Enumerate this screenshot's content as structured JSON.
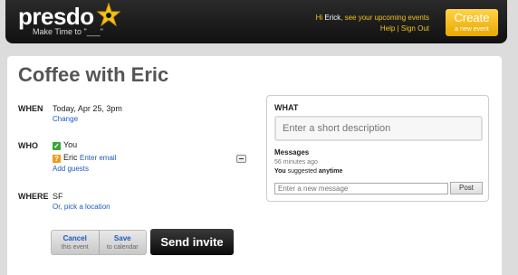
{
  "header": {
    "logo": "presdo",
    "tagline": "Make Time to \"___\"",
    "greeting_prefix": "Hi",
    "greeting_user": "Erick",
    "greeting_suffix": ", see your upcoming events",
    "help_link": "Help",
    "separator": "|",
    "signout_link": "Sign Out",
    "create_label": "Create",
    "create_sub": "a new event",
    "colors": {
      "accent": "#f0c419",
      "background": "#111111"
    }
  },
  "event": {
    "title": "Coffee with Eric",
    "when": {
      "label": "WHEN",
      "value": "Today, Apr 25, 3pm",
      "change_link": "Change"
    },
    "who": {
      "label": "WHO",
      "attendees": [
        {
          "name": "You",
          "status_icon": "check-icon"
        },
        {
          "name": "Eric",
          "status_icon": "question-icon",
          "action": "Enter email"
        }
      ],
      "add_guests_link": "Add guests"
    },
    "where": {
      "label": "WHERE",
      "value": "SF",
      "pick_location_link": "Or, pick a location"
    },
    "buttons": {
      "cancel_label": "Cancel",
      "cancel_sub": "this event",
      "save_label": "Save",
      "save_sub": "to calendar",
      "send_label": "Send invite"
    }
  },
  "what": {
    "label": "WHAT",
    "description_placeholder": "Enter a short description",
    "messages_label": "Messages",
    "messages": [
      {
        "time": "56 minutes ago",
        "author": "You",
        "text_prefix": " suggested ",
        "text_value": "anytime"
      }
    ],
    "new_message_placeholder": "Enter a new message",
    "post_label": "Post"
  }
}
